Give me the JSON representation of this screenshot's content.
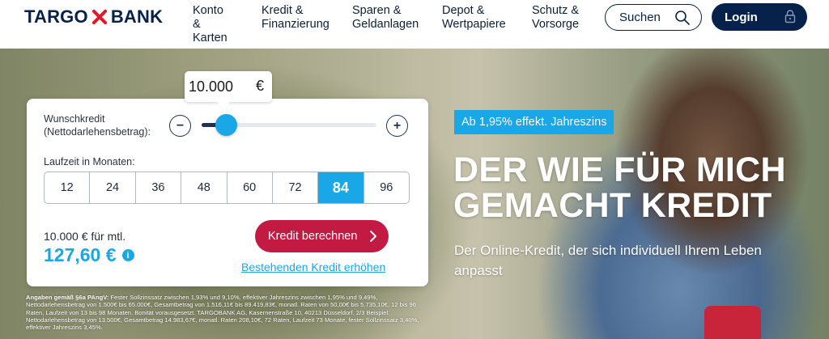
{
  "header": {
    "logo_left": "TARGO",
    "logo_right": "BANK",
    "nav": [
      {
        "label": "Konto &\nKarten"
      },
      {
        "label": "Kredit &\nFinanzierung"
      },
      {
        "label": "Sparen &\nGeldanlagen"
      },
      {
        "label": "Depot &\nWertpapiere"
      },
      {
        "label": "Schutz &\nVorsorge"
      }
    ],
    "search_label": "Suchen",
    "login_label": "Login"
  },
  "calculator": {
    "amount_label": "Wunschkredit\n(Nettodarlehensbetrag):",
    "amount_value": "10.000",
    "amount_currency": "€",
    "slider_fraction": 0.14,
    "minus_label": "−",
    "plus_label": "+",
    "term_label": "Laufzeit in Monaten:",
    "terms": [
      "12",
      "24",
      "36",
      "48",
      "60",
      "72",
      "84",
      "96"
    ],
    "selected_term": "84",
    "monthly_label": "10.000 € für mtl.",
    "monthly_value": "127,60 €",
    "info_icon": "i",
    "calc_button": "Kredit berechnen",
    "raise_link": "Bestehenden Kredit erhöhen"
  },
  "hero": {
    "badge": "Ab 1,95% effekt. Jahreszins",
    "headline": "DER WIE FÜR MICH\nGEMACHT KREDIT",
    "subline": "Der Online-Kredit, der sich individuell Ihrem Leben anpasst"
  },
  "legal": {
    "bold": "Angaben gemäß §6a PAngV:",
    "text": " Fester Sollzinssatz zwischen 1,93% und 9,10%, effektiver Jahreszins zwischen 1,95% und 9,49%, Nettodarlehensbetrag von 1.500€ bis 65.000€, Gesamtbetrag von 1.516,11€ bis 89.419,83€, monatl. Raten von 50,00€ bis 5.735,10€, 12 bis 96 Raten, Laufzeit von 13 bis 98 Monaten. Bonität vorausgesetzt. TARGOBANK AG, Kasernenstraße 10, 40213 Düsseldorf. 2/3 Beispiel: Nettodarlehensbetrag von 13.500€, Gesamtbetrag 14.983,67€, monatl. Raten 208,10€, 72 Raten, Laufzeit 73 Monate, fester Sollzinssatz 3,40%, effektiver Jahreszins 3,45%."
  },
  "colors": {
    "brand_navy": "#06214a",
    "accent_blue": "#1aa7e8",
    "cta_red": "#c21a42",
    "logo_red": "#e0192d"
  },
  "icons": {
    "logo": "targo-x-icon",
    "search": "search-icon",
    "login": "lock-icon",
    "info": "info-icon",
    "chevron": "chevron-right-icon"
  }
}
